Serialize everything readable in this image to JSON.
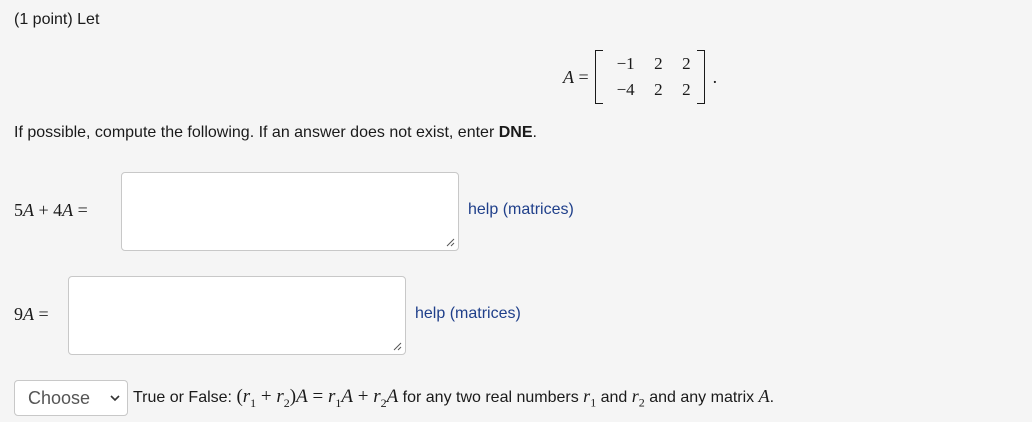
{
  "problem": {
    "header": "(1 point) Let",
    "matrix": {
      "name": "A",
      "equals": "=",
      "rows": [
        [
          "−1",
          "2",
          "2"
        ],
        [
          "−4",
          "2",
          "2"
        ]
      ],
      "trailing": "."
    },
    "instruction_prefix": "If possible, compute the following. If an answer does not exist, enter ",
    "instruction_bold": "DNE",
    "instruction_suffix": "."
  },
  "questions": [
    {
      "label_parts": [
        "5",
        "A",
        " + 4",
        "A",
        " ="
      ],
      "answer_value": "",
      "help_text": "help (matrices)"
    },
    {
      "label_parts": [
        "9",
        "A",
        " ="
      ],
      "answer_value": "",
      "help_text": "help (matrices)"
    }
  ],
  "true_false": {
    "select": {
      "selected": "Choose",
      "options": [
        "Choose"
      ]
    },
    "statement": {
      "prefix": "True or False: ",
      "equation_parts": [
        "(",
        "r",
        "1",
        " + ",
        "r",
        "2",
        ")",
        "A",
        " = ",
        "r",
        "1",
        "A",
        " + ",
        "r",
        "2",
        "A"
      ],
      "middle": " for any two real numbers ",
      "r1_parts": [
        "r",
        "1"
      ],
      "and": " and ",
      "r2_parts": [
        "r",
        "2"
      ],
      "suffix_text": " and any matrix ",
      "matrix_name": "A",
      "end": "."
    }
  },
  "colors": {
    "background": "#f5f5f5",
    "link": "#1f3f8a",
    "input_border": "#c8c8c8"
  },
  "icons": {
    "resize_grip": "resize-grip-icon",
    "select_chevron": "chevron-down-icon"
  }
}
